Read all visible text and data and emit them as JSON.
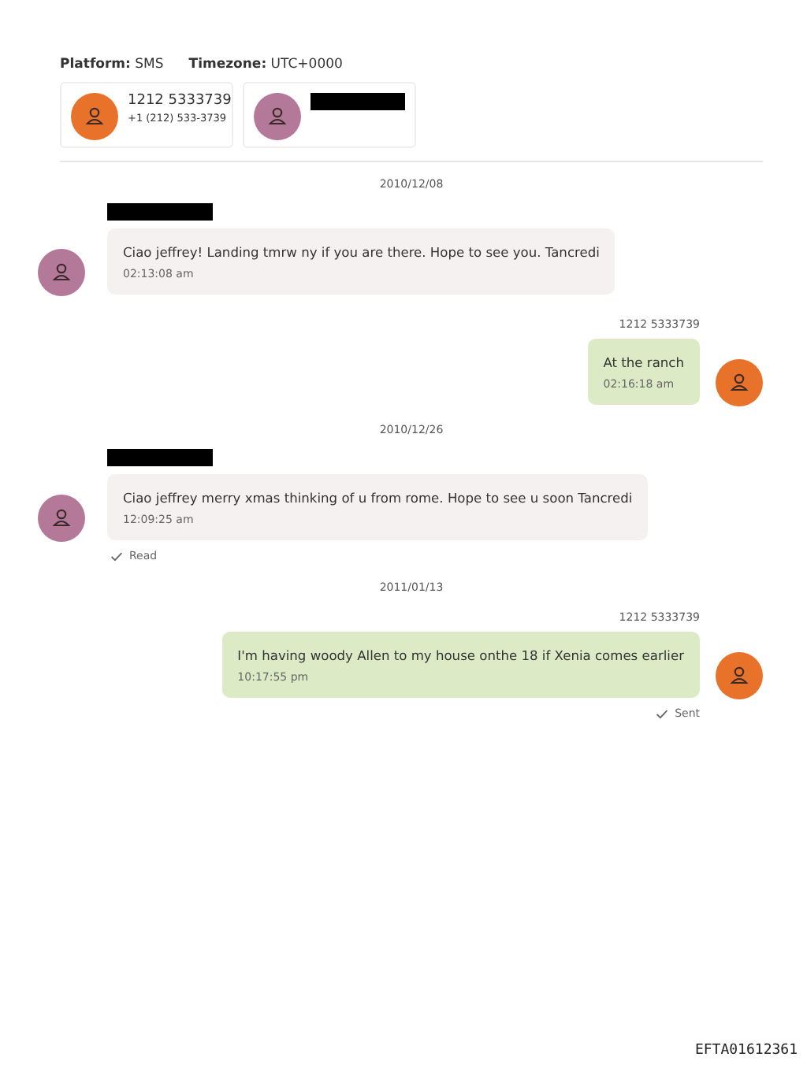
{
  "header": {
    "platform_label": "Platform:",
    "platform": "SMS",
    "timezone_label": "Timezone:",
    "timezone": "UTC+0000"
  },
  "participants": [
    {
      "name": "1212 5333739",
      "phone": "+1 (212) 533-3739",
      "color": "#e8722a",
      "redacted": false
    },
    {
      "color": "#b47898",
      "redacted": true
    }
  ],
  "thread": [
    {
      "kind": "date",
      "text": "2010/12/08"
    },
    {
      "kind": "incoming",
      "sender_redacted": true,
      "color": "#b47898",
      "text": "Ciao jeffrey! Landing tmrw ny if you are there. Hope to see you. Tancredi",
      "time": "02:13:08 am"
    },
    {
      "kind": "outgoing",
      "sender": "1212 5333739",
      "color": "#e8722a",
      "text": "At the ranch",
      "time": "02:16:18 am"
    },
    {
      "kind": "date",
      "text": "2010/12/26"
    },
    {
      "kind": "incoming",
      "sender_redacted": true,
      "color": "#b47898",
      "text": "Ciao jeffrey merry xmas thinking of u from rome. Hope to see u soon Tancredi",
      "time": "12:09:25 am",
      "status": "Read"
    },
    {
      "kind": "date",
      "text": "2011/01/13"
    },
    {
      "kind": "outgoing",
      "sender": "1212 5333739",
      "color": "#e8722a",
      "text": "I'm having woody Allen to my house onthe 18 if Xenia comes earlier",
      "time": "10:17:55 pm",
      "status": "Sent"
    }
  ],
  "footer": "EFTA01612361"
}
